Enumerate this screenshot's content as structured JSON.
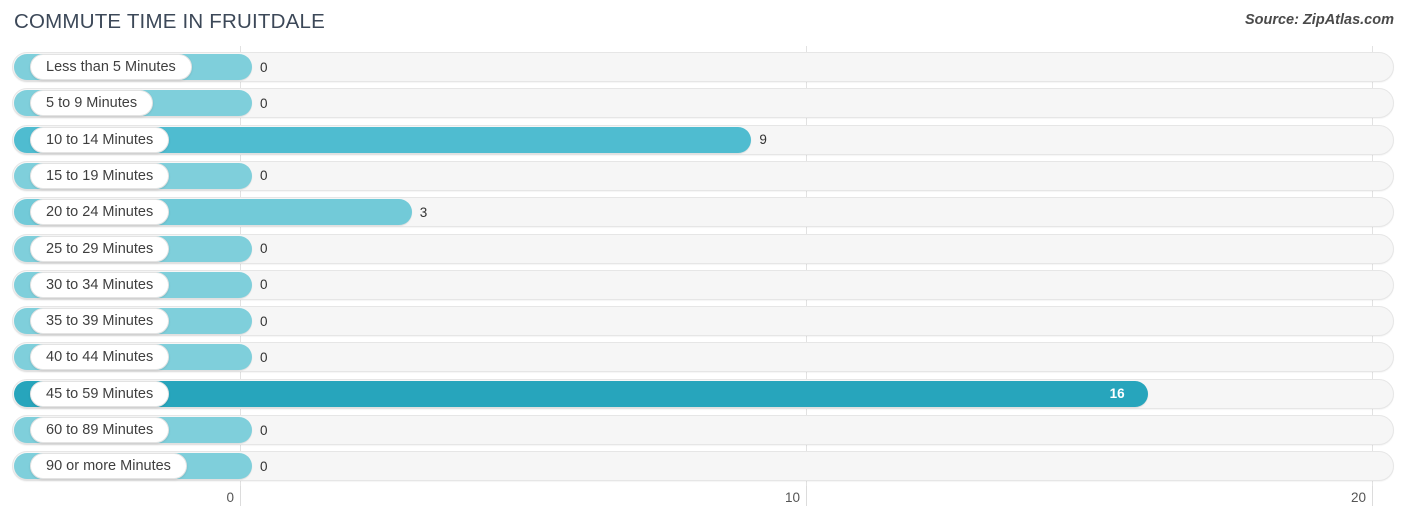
{
  "header": {
    "title": "COMMUTE TIME IN FRUITDALE",
    "source": "Source: ZipAtlas.com"
  },
  "axis": {
    "ticks": [
      {
        "label": "0",
        "value": 0
      },
      {
        "label": "10",
        "value": 10
      },
      {
        "label": "20",
        "value": 20
      }
    ]
  },
  "chart_data": {
    "type": "bar",
    "orientation": "horizontal",
    "title": "COMMUTE TIME IN FRUITDALE",
    "xlabel": "",
    "ylabel": "",
    "xlim": [
      0,
      20
    ],
    "grid": true,
    "legend": "none",
    "source": "Source: ZipAtlas.com",
    "categories": [
      "Less than 5 Minutes",
      "5 to 9 Minutes",
      "10 to 14 Minutes",
      "15 to 19 Minutes",
      "20 to 24 Minutes",
      "25 to 29 Minutes",
      "30 to 34 Minutes",
      "35 to 39 Minutes",
      "40 to 44 Minutes",
      "45 to 59 Minutes",
      "60 to 89 Minutes",
      "90 or more Minutes"
    ],
    "values": [
      0,
      0,
      9,
      0,
      3,
      0,
      0,
      0,
      0,
      16,
      0,
      0
    ],
    "value_labels": [
      "0",
      "0",
      "9",
      "0",
      "3",
      "0",
      "0",
      "0",
      "0",
      "16",
      "0",
      "0"
    ],
    "bar_colors": [
      "#7FCFDB",
      "#7FCFDB",
      "#4FBCD0",
      "#7FCFDB",
      "#72CAD8",
      "#7FCFDB",
      "#7FCFDB",
      "#7FCFDB",
      "#7FCFDB",
      "#27A5BC",
      "#7FCFDB",
      "#7FCFDB"
    ],
    "colors": {
      "track": "#f6f6f6",
      "track_border": "#e6e6e6",
      "gridline": "#e2e2e2",
      "title_text": "#3c4858",
      "label_text": "#3f3f3f",
      "value_text_outside": "#333333",
      "value_text_inside": "#ffffff"
    }
  }
}
